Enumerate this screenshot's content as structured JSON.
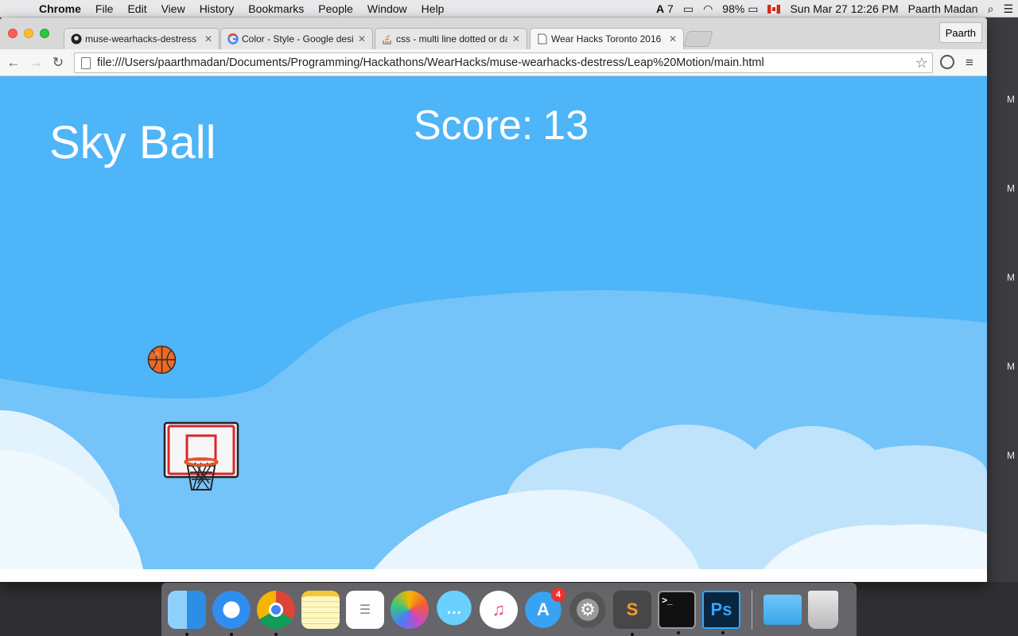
{
  "menubar": {
    "app": "Chrome",
    "items": [
      "File",
      "Edit",
      "View",
      "History",
      "Bookmarks",
      "People",
      "Window",
      "Help"
    ],
    "status": {
      "adobe_count": "7",
      "battery": "98%",
      "datetime": "Sun Mar 27  12:26 PM",
      "user": "Paarth Madan"
    }
  },
  "browser": {
    "tabs": [
      {
        "label": "muse-wearhacks-destress",
        "icon": "github-icon"
      },
      {
        "label": "Color - Style - Google desi",
        "icon": "google-icon"
      },
      {
        "label": "css - multi line dotted or da",
        "icon": "stackoverflow-icon"
      },
      {
        "label": "Wear Hacks Toronto 2016",
        "icon": "page-icon"
      }
    ],
    "active_tab": 3,
    "profile": "Paarth",
    "url": "file:///Users/paarthmadan/Documents/Programming/Hackathons/WearHacks/muse-wearhacks-destress/Leap%20Motion/main.html"
  },
  "game": {
    "title": "Sky Ball",
    "score_label": "Score:",
    "score_value": "13"
  },
  "desktop": {
    "right_edge_labels": [
      "M",
      "M",
      "M",
      "M",
      "M"
    ]
  },
  "dock": {
    "apps": [
      "Finder",
      "Safari",
      "Chrome",
      "Notes",
      "Reminders",
      "Photos",
      "Messages",
      "iTunes",
      "App Store",
      "System Preferences",
      "Sublime Text",
      "Terminal",
      "Photoshop"
    ],
    "app_store_badge": "4",
    "extras": [
      "Folder",
      "Trash"
    ]
  }
}
